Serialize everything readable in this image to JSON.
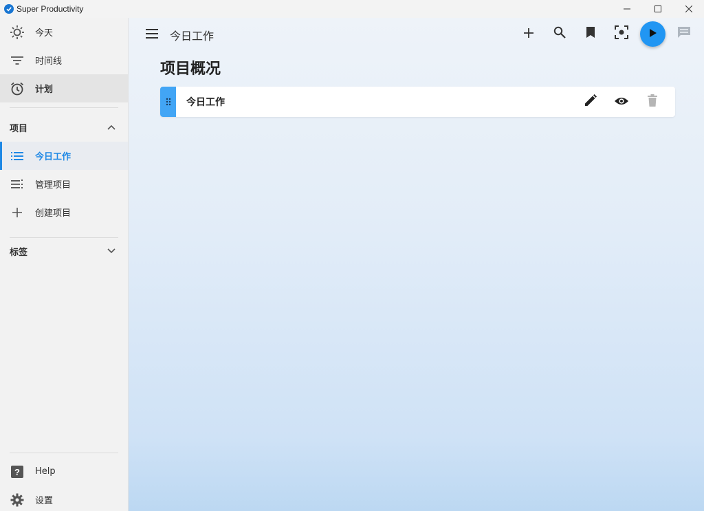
{
  "window": {
    "title": "Super Productivity"
  },
  "sidebar": {
    "main_items": [
      {
        "label": "今天",
        "icon": "sun-icon"
      },
      {
        "label": "时间线",
        "icon": "filter-lines-icon"
      },
      {
        "label": "计划",
        "icon": "alarm-clock-icon"
      }
    ],
    "projects_section": {
      "label": "项目",
      "expanded": true
    },
    "project_items": [
      {
        "label": "今日工作",
        "icon": "list-icon",
        "active": true
      },
      {
        "label": "管理项目",
        "icon": "manage-list-icon"
      },
      {
        "label": "创建项目",
        "icon": "plus-icon"
      }
    ],
    "tags_section": {
      "label": "标签",
      "expanded": false
    },
    "bottom_items": [
      {
        "label": "Help",
        "icon": "help-icon"
      },
      {
        "label": "设置",
        "icon": "gear-icon"
      }
    ]
  },
  "header": {
    "title": "今日工作",
    "actions": [
      "add-icon",
      "search-icon",
      "bookmark-icon",
      "focus-icon",
      "play-icon",
      "comment-icon"
    ]
  },
  "main": {
    "heading": "项目概况",
    "projects": [
      {
        "title": "今日工作"
      }
    ]
  },
  "colors": {
    "accent": "#2196f3",
    "active_text": "#1e88e5",
    "drag_handle": "#42a5f5"
  }
}
